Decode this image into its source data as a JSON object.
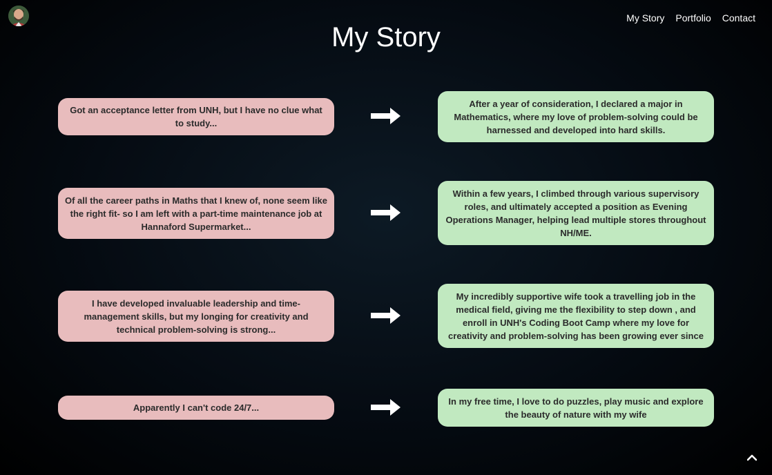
{
  "header": {
    "avatar_alt": "profile avatar",
    "nav": [
      {
        "label": "My Story"
      },
      {
        "label": "Portfolio"
      },
      {
        "label": "Contact"
      }
    ]
  },
  "page": {
    "title": "My Story"
  },
  "story": [
    {
      "before": "Got an acceptance letter from UNH, but I have no clue what to study...",
      "after": "After a year of consideration, I declared a major in Mathematics, where my love of problem-solving could be harnessed and developed into hard skills."
    },
    {
      "before": "Of all the career paths in Maths that I knew of, none seem like the right fit- so I am left with a part-time maintenance job at Hannaford Supermarket...",
      "after": "Within a few years, I climbed through various supervisory roles, and ultimately accepted a position as Evening Operations Manager, helping lead multiple stores throughout NH/ME."
    },
    {
      "before": "I have developed invaluable leadership and time-management skills, but my longing for creativity and technical problem-solving is strong...",
      "after": "My incredibly supportive wife took a travelling job in the medical field, giving me the flexibility to step down , and enroll in UNH's Coding Boot Camp where my love for creativity and problem-solving has been growing ever since"
    },
    {
      "before": "Apparently I can't code 24/7...",
      "after": "In my free time, I love to do puzzles, play music and explore the beauty of nature with my wife"
    }
  ],
  "colors": {
    "left_card": "#e8bcbd",
    "right_card": "#c1e9c0",
    "background": "#050b12"
  },
  "icons": {
    "arrow": "right-arrow-icon",
    "scroll_top": "chevron-up-icon"
  }
}
